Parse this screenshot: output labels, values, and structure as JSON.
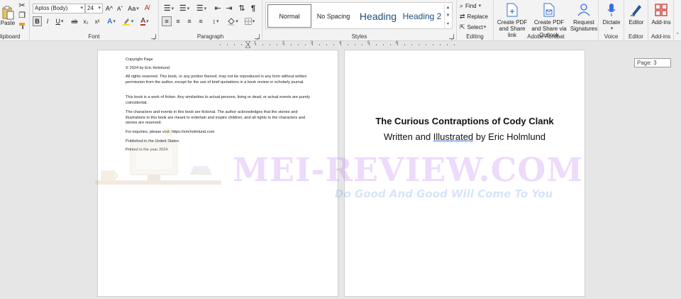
{
  "ribbon": {
    "clipboard": {
      "paste_label": "Paste",
      "group_label": "lipboard"
    },
    "font": {
      "font_name": "Aptos (Body)",
      "font_size": "24",
      "bold": "B",
      "italic": "I",
      "underline": "U",
      "strike": "ab",
      "subscript": "x₂",
      "superscript": "x²",
      "grow": "A^",
      "shrink": "Aˇ",
      "case": "Aa",
      "group_label": "Font"
    },
    "paragraph": {
      "group_label": "Paragraph",
      "pilcrow": "¶"
    },
    "styles": {
      "items": [
        "Normal",
        "No Spacing",
        "Heading",
        "Heading 2"
      ],
      "group_label": "Styles"
    },
    "editing": {
      "find": "Find",
      "replace": "Replace",
      "select": "Select",
      "group_label": "Editing"
    },
    "acrobat": {
      "create_pdf_share_link": "Create PDF and Share link",
      "create_pdf_outlook": "Create PDF and Share via Outlook",
      "request_signatures": "Request Signatures",
      "group_label": "Adobe Acrobat"
    },
    "voice": {
      "dictate": "Dictate",
      "group_label": "Voice"
    },
    "editor": {
      "editor": "Editor",
      "group_label": "Editor"
    },
    "addins": {
      "addins": "Add-ins",
      "group_label": "Add-ins"
    }
  },
  "ruler": {
    "numbers": [
      "1",
      "2",
      "3",
      "4",
      "5",
      "6"
    ]
  },
  "page_left": {
    "lines": [
      "Copyright Page",
      "© 2024 by Eric Holmlund",
      "All rights reserved. This book, or any portion thereof, may not be reproduced in any form without written permission from the author, except for the use of brief quotations in a book review or scholarly journal.",
      "This book is a work of fiction. Any similarities to actual persons, living or dead, or actual events are purely coincidental.",
      "The characters and events in this book are fictional. The author acknowledges that the stories and illustrations in this book are meant to entertain and inspire children, and all rights to the characters and stories are reserved.",
      "For inquiries, please visit: https://ericholmlund.com",
      "Published in the United States.",
      "Printed in the year 2024."
    ]
  },
  "page_right": {
    "title": "The Curious Contraptions of Cody Clank",
    "byline_prefix": "Written and ",
    "byline_spell": "Illustrated",
    "byline_suffix": " by Eric Holmlund"
  },
  "status": {
    "page_indicator": "Page: 3"
  },
  "watermark": {
    "title": "MEI-REVIEW.COM",
    "tagline": "Do Good And Good Will Come To You"
  },
  "colors": {
    "accent_blue": "#2b579a",
    "heading_blue": "#1f4e79",
    "acrobat_blue": "#3a6fd8",
    "addins_red": "#c9352b"
  }
}
